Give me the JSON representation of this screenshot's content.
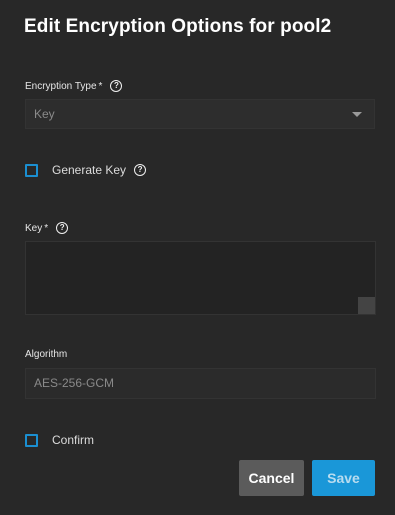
{
  "dialog": {
    "title": "Edit Encryption Options for pool2"
  },
  "encryption_type": {
    "label": "Encryption Type",
    "required_mark": "*",
    "help_icon": "question-circle-icon",
    "value": "Key"
  },
  "generate_key": {
    "label": "Generate Key",
    "checked": false,
    "help_icon": "question-circle-icon"
  },
  "key": {
    "label": "Key",
    "required_mark": "*",
    "help_icon": "question-circle-icon",
    "value": ""
  },
  "algorithm": {
    "label": "Algorithm",
    "value": "AES-256-GCM"
  },
  "confirm": {
    "label": "Confirm",
    "checked": false
  },
  "actions": {
    "cancel_label": "Cancel",
    "save_label": "Save"
  },
  "colors": {
    "accent": "#1a97d8",
    "background": "#282828",
    "checkbox_border": "#1b8fd1"
  },
  "help_glyph": "?"
}
